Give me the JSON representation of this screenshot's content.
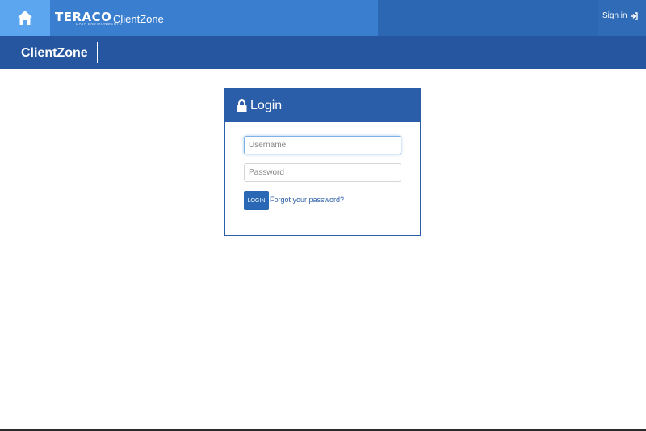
{
  "topbar": {
    "home_icon": "home-icon",
    "logo_text": "TERACO",
    "logo_subtitle": "DATA ENVIRONMENTS",
    "app_title": "ClientZone",
    "signin_label": "Sign in",
    "signin_icon": "sign-in-icon",
    "colors": {
      "bar": "#3a7fcf",
      "home": "#5ba6ee"
    }
  },
  "subbar": {
    "title": "ClientZone",
    "color": "#2656a0"
  },
  "login_panel": {
    "title": "Login",
    "lock_icon": "lock-icon",
    "username_placeholder": "Username",
    "password_placeholder": "Password",
    "login_button": "LOGIN",
    "forgot_link": "Forgot your password?"
  }
}
